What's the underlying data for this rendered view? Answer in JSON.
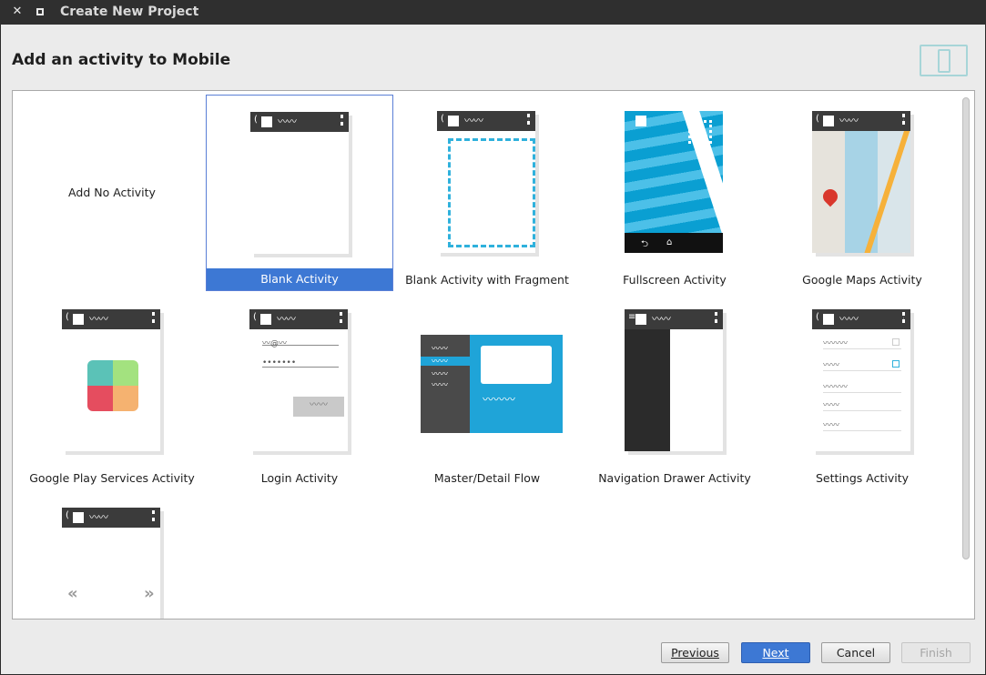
{
  "window": {
    "title": "Create New Project"
  },
  "heading": "Add an activity to Mobile",
  "tiles": [
    {
      "label": "Add No Activity"
    },
    {
      "label": "Blank Activity",
      "selected": true
    },
    {
      "label": "Blank Activity with Fragment"
    },
    {
      "label": "Fullscreen Activity"
    },
    {
      "label": "Google Maps Activity"
    },
    {
      "label": "Google Play Services Activity"
    },
    {
      "label": "Login Activity"
    },
    {
      "label": "Master/Detail Flow"
    },
    {
      "label": "Navigation Drawer Activity"
    },
    {
      "label": "Settings Activity"
    },
    {
      "label": ""
    }
  ],
  "buttons": {
    "previous": "Previous",
    "next": "Next",
    "cancel": "Cancel",
    "finish": "Finish"
  },
  "colors": {
    "selection": "#3d78d4",
    "accent": "#2fb1dc"
  }
}
